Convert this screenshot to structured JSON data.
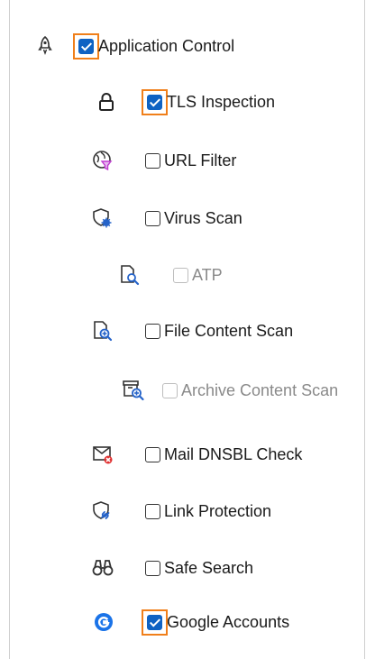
{
  "items": [
    {
      "label": "Application Control",
      "checked": true,
      "enabled": true,
      "focused": true,
      "icon": "rocket-icon"
    },
    {
      "label": "TLS Inspection",
      "checked": true,
      "enabled": true,
      "focused": true,
      "icon": "lock-icon"
    },
    {
      "label": "URL Filter",
      "checked": false,
      "enabled": true,
      "focused": false,
      "icon": "globe-filter-icon"
    },
    {
      "label": "Virus Scan",
      "checked": false,
      "enabled": true,
      "focused": false,
      "icon": "shield-virus-icon"
    },
    {
      "label": "ATP",
      "checked": false,
      "enabled": false,
      "focused": false,
      "icon": "document-search-icon"
    },
    {
      "label": "File Content Scan",
      "checked": false,
      "enabled": true,
      "focused": false,
      "icon": "file-scan-icon"
    },
    {
      "label": "Archive Content Scan",
      "checked": false,
      "enabled": false,
      "focused": false,
      "icon": "archive-scan-icon"
    },
    {
      "label": "Mail DNSBL Check",
      "checked": false,
      "enabled": true,
      "focused": false,
      "icon": "mail-blocked-icon"
    },
    {
      "label": "Link Protection",
      "checked": false,
      "enabled": true,
      "focused": false,
      "icon": "shield-link-icon"
    },
    {
      "label": "Safe Search",
      "checked": false,
      "enabled": true,
      "focused": false,
      "icon": "binoculars-icon"
    },
    {
      "label": "Google Accounts",
      "checked": true,
      "enabled": true,
      "focused": true,
      "icon": "google-icon"
    }
  ],
  "colors": {
    "checkbox_checked": "#0f62c3",
    "focus_outline": "#f07f1a",
    "google_blue": "#1a73e8",
    "accent_purple": "#c03bd1",
    "accent_red": "#e03030",
    "icon_blue": "#2563c9"
  }
}
